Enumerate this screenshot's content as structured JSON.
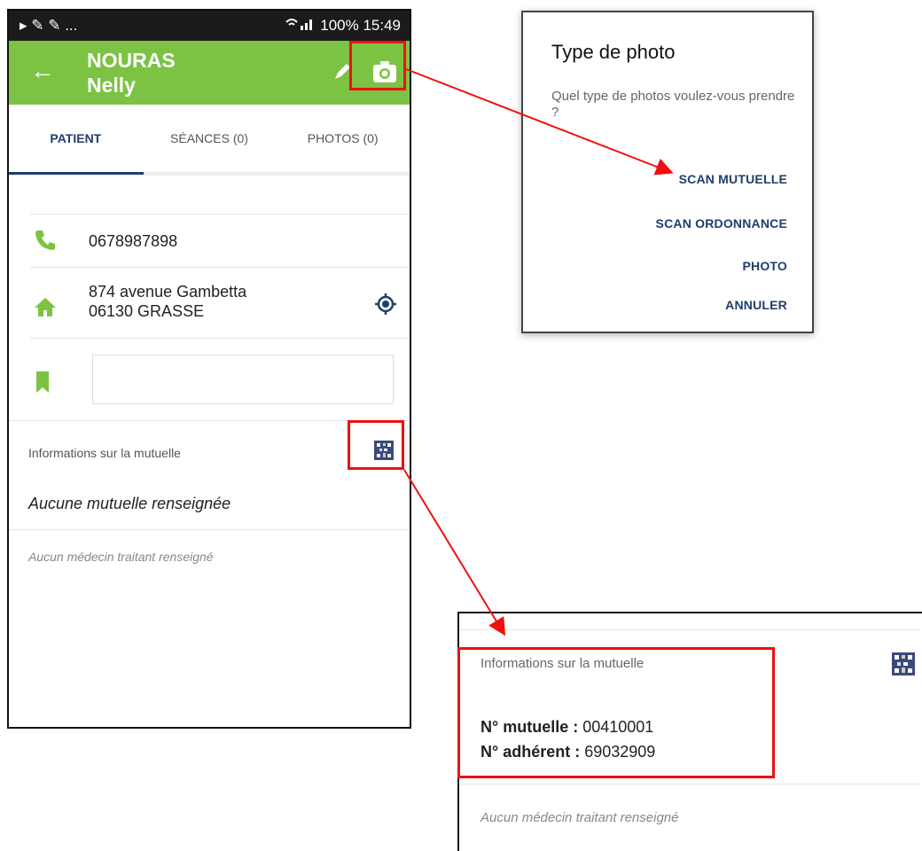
{
  "phone": {
    "status_left": "▸ ✎ ✎ ...",
    "status_right": "100% 15:49",
    "patient_last_name": "NOURAS",
    "patient_first_name": "Nelly",
    "tabs": [
      {
        "label": "PATIENT",
        "active": true
      },
      {
        "label": "SÉANCES (0)",
        "active": false
      },
      {
        "label": "PHOTOS (0)",
        "active": false
      }
    ],
    "phone_number": "0678987898",
    "address_line1": "874 avenue Gambetta",
    "address_line2": "06130 GRASSE",
    "mutuelle_label": "Informations sur la mutuelle",
    "mutuelle_none": "Aucune mutuelle renseignée",
    "medecin_none": "Aucun médecin traitant renseigné",
    "accent_color": "#7cc243",
    "tab_color": "#1f3e6b"
  },
  "dialog": {
    "title": "Type de photo",
    "message": "Quel type de photos voulez-vous prendre ?",
    "options": [
      "SCAN MUTUELLE",
      "SCAN ORDONNANCE",
      "PHOTO",
      "ANNULER"
    ]
  },
  "result": {
    "label": "Informations sur la mutuelle",
    "mutuelle_key": "N° mutuelle :",
    "mutuelle_value": "00410001",
    "adherent_key": "N° adhérent :",
    "adherent_value": "69032909",
    "medecin_none": "Aucun médecin traitant renseigné"
  }
}
